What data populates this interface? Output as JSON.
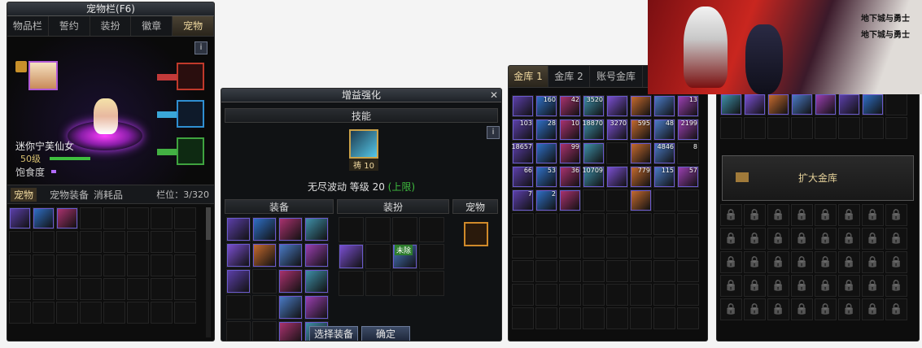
{
  "pet_panel": {
    "title": "宠物栏(F6)",
    "tabs": [
      "物品栏",
      "誓约",
      "装扮",
      "徽章",
      "宠物"
    ],
    "active_tab": 4,
    "pet_name": "迷你宁芙仙女",
    "pet_level": "50级",
    "satiety_label": "饱食度",
    "bottom_tabs": [
      "宠物",
      "宠物装备",
      "消耗品"
    ],
    "slot_count": "栏位：3/320",
    "info": "i"
  },
  "enhance_panel": {
    "title": "增益强化",
    "skill_header": "技能",
    "skill_value": "祷 10",
    "skill_line": "无尽波动 等级 20",
    "skill_limit": "(上限)",
    "col_equip": "装备",
    "col_avatar": "装扮",
    "col_pet": "宠物",
    "avatar_badge": "未除",
    "btn_select": "选择装备",
    "btn_confirm": "确定",
    "info": "i"
  },
  "vault_panel": {
    "tabs": [
      "金库 1",
      "金库 2",
      "账号金库"
    ],
    "active_tab": 0,
    "rows": [
      [
        "",
        "160",
        "42",
        "3520",
        "",
        "",
        "",
        "13",
        ""
      ],
      [
        "103",
        "28",
        "10",
        "18870",
        "3270",
        "595",
        "48",
        "2199",
        ""
      ],
      [
        "18657",
        "",
        "99",
        "",
        "",
        "",
        "4846",
        "8",
        ""
      ],
      [
        "66",
        "53",
        "36",
        "10709",
        "",
        "779",
        "115",
        "57",
        ""
      ],
      [
        "7",
        "2",
        "",
        "",
        "",
        "",
        "",
        "",
        ""
      ]
    ]
  },
  "account_vault": {
    "expand_button": "扩大金库",
    "lock_glyph": "🔒"
  },
  "banner": {
    "logo_text_1": "地下城与勇士",
    "logo_text_2": "地下城与勇士"
  },
  "colors": {
    "gold": "#f0d9a0",
    "green": "#3fbf3f",
    "cyan_limit": "#4fd8ff",
    "purple": "#b26bff"
  }
}
